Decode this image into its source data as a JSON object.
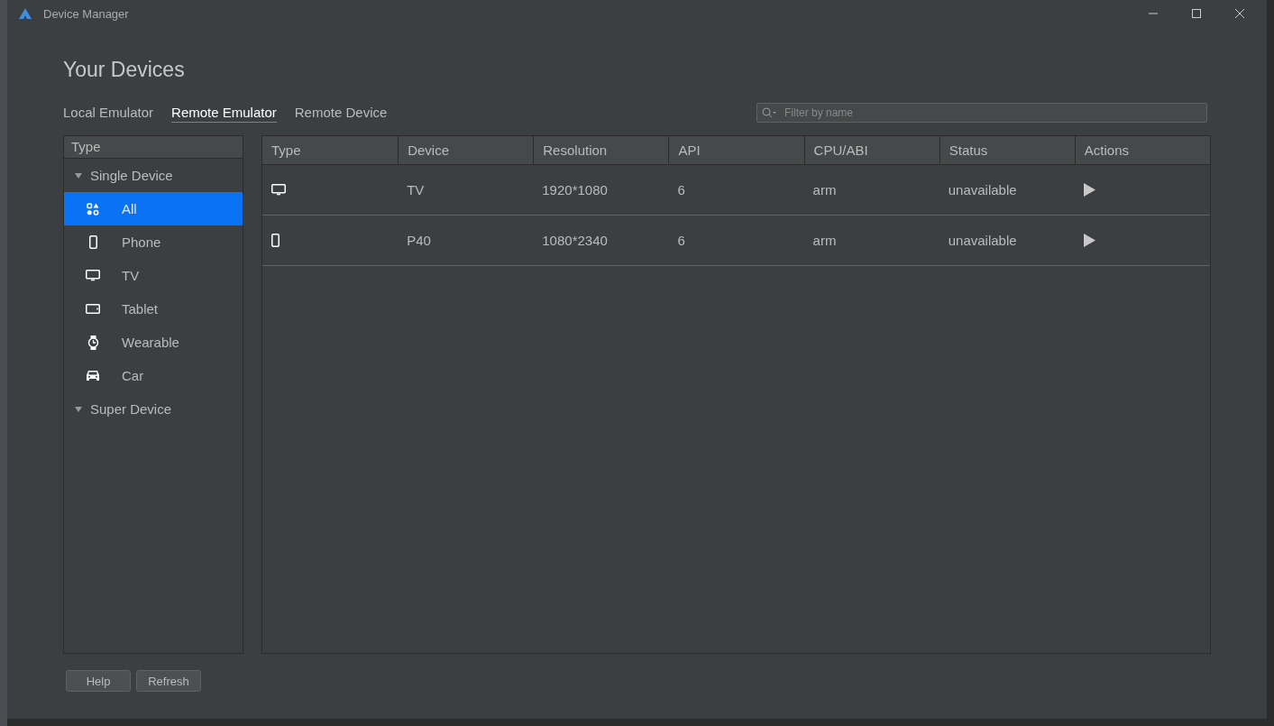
{
  "window": {
    "title": "Device Manager"
  },
  "heading": "Your Devices",
  "tabs": [
    {
      "label": "Local Emulator",
      "selected": false
    },
    {
      "label": "Remote Emulator",
      "selected": true
    },
    {
      "label": "Remote Device",
      "selected": false
    }
  ],
  "search": {
    "placeholder": "Filter by name"
  },
  "sidebar": {
    "header": "Type",
    "groups": [
      {
        "label": "Single Device",
        "expanded": true,
        "children": [
          {
            "label": "All",
            "kind": "all",
            "selected": true
          },
          {
            "label": "Phone",
            "kind": "phone",
            "selected": false
          },
          {
            "label": "TV",
            "kind": "tv",
            "selected": false
          },
          {
            "label": "Tablet",
            "kind": "tablet",
            "selected": false
          },
          {
            "label": "Wearable",
            "kind": "watch",
            "selected": false
          },
          {
            "label": "Car",
            "kind": "car",
            "selected": false
          }
        ]
      },
      {
        "label": "Super Device",
        "expanded": true
      }
    ]
  },
  "table": {
    "columns": [
      "Type",
      "Device",
      "Resolution",
      "API",
      "CPU/ABI",
      "Status",
      "Actions"
    ],
    "rows": [
      {
        "kind": "tv",
        "device": "TV",
        "resolution": "1920*1080",
        "api": "6",
        "cpu": "arm",
        "status": "unavailable"
      },
      {
        "kind": "phone",
        "device": "P40",
        "resolution": "1080*2340",
        "api": "6",
        "cpu": "arm",
        "status": "unavailable"
      }
    ]
  },
  "buttons": [
    "Help",
    "Refresh"
  ]
}
